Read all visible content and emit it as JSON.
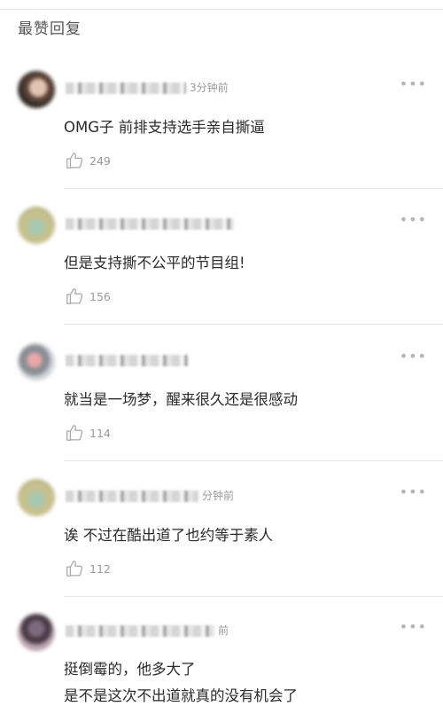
{
  "section_title": "最赞回复",
  "colors": {
    "text": "#2a2a2a",
    "meta": "#9a9a9a",
    "divider": "#e8e8e8"
  },
  "more_icon": "more-dots-icon",
  "like_icon": "thumbs-up-icon",
  "comments": [
    {
      "time": "3分钟前",
      "lines": [
        "OMG子 前排支持选手亲自撕逼"
      ],
      "likes": "249"
    },
    {
      "time": "",
      "lines": [
        "但是支持撕不公平的节目组!"
      ],
      "likes": "156"
    },
    {
      "time": "",
      "lines": [
        "就当是一场梦，醒来很久还是很感动"
      ],
      "likes": "114"
    },
    {
      "time": "分钟前",
      "lines": [
        "诶  不过在酷出道了也约等于素人"
      ],
      "likes": "112"
    },
    {
      "time": "前",
      "lines": [
        "挺倒霉的，他多大了",
        "是不是这次不出道就真的没有机会了"
      ],
      "likes": ""
    }
  ]
}
